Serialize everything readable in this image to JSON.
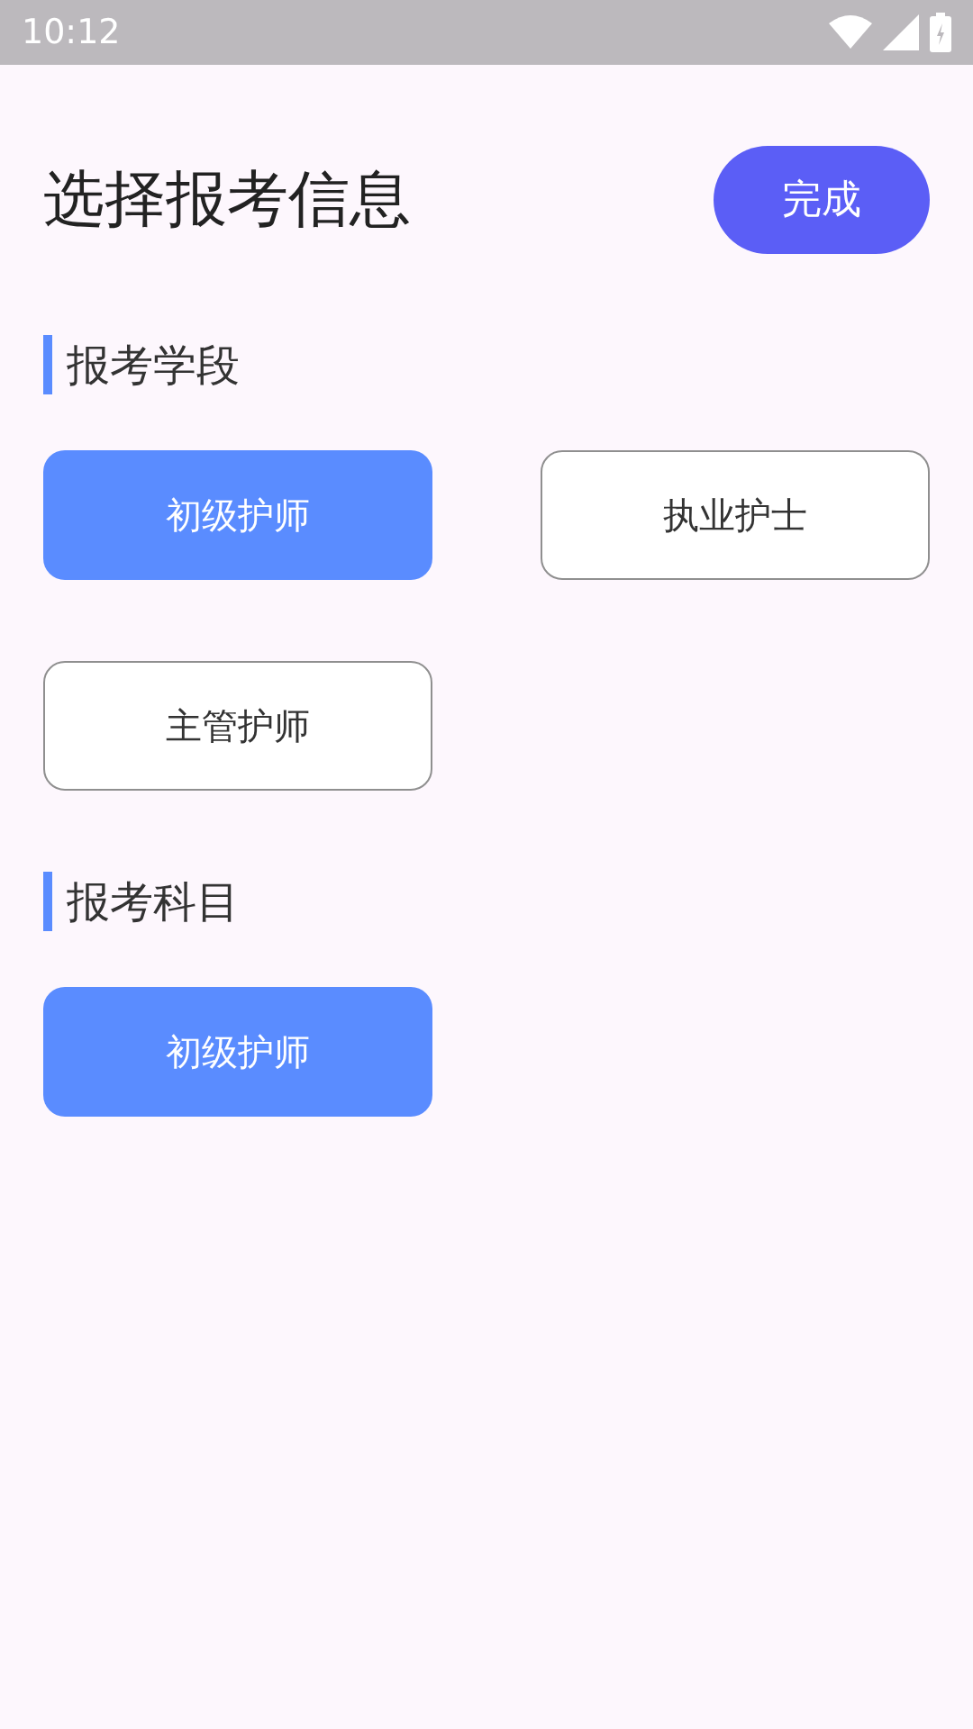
{
  "status_bar": {
    "time": "10:12"
  },
  "header": {
    "title": "选择报考信息",
    "done_button": "完成"
  },
  "sections": [
    {
      "title": "报考学段",
      "options": [
        {
          "label": "初级护师",
          "selected": true
        },
        {
          "label": "执业护士",
          "selected": false
        },
        {
          "label": "主管护师",
          "selected": false
        }
      ]
    },
    {
      "title": "报考科目",
      "options": [
        {
          "label": "初级护师",
          "selected": true
        }
      ]
    }
  ]
}
